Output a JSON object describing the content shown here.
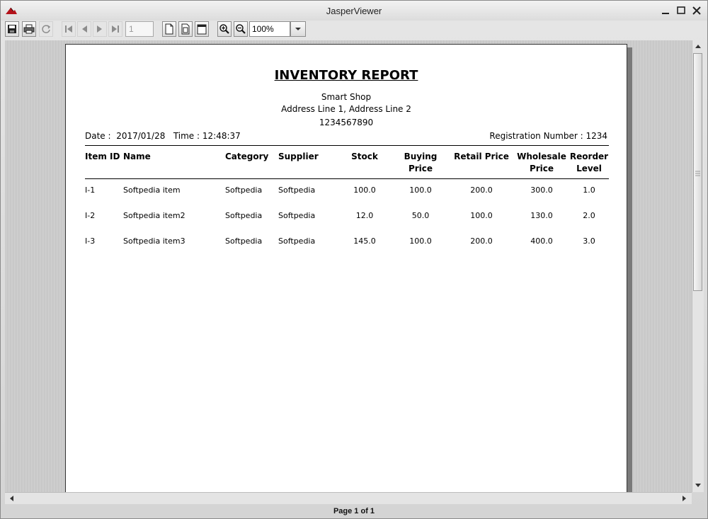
{
  "window": {
    "title": "JasperViewer"
  },
  "toolbar": {
    "page_number": "1",
    "zoom": "100%"
  },
  "report": {
    "title": "INVENTORY REPORT",
    "company": "Smart Shop",
    "address": "Address Line 1, Address Line 2",
    "phone": "1234567890",
    "date_label": "Date :",
    "date": "2017/01/28",
    "time_label": "Time :",
    "time": "12:48:37",
    "registration": "Registration Number : 1234",
    "columns": {
      "id": "Item ID",
      "name": "Name",
      "category": "Category",
      "supplier": "Supplier",
      "stock": "Stock",
      "buying_1": "Buying",
      "buying_2": "Price",
      "retail": "Retail Price",
      "wholesale_1": "Wholesale",
      "wholesale_2": "Price",
      "reorder_1": "Reorder",
      "reorder_2": "Level"
    },
    "rows": [
      {
        "id": "I-1",
        "name": "Softpedia item",
        "category": "Softpedia",
        "supplier": "Softpedia",
        "stock": "100.0",
        "buying": "100.0",
        "retail": "200.0",
        "wholesale": "300.0",
        "reorder": "1.0"
      },
      {
        "id": "I-2",
        "name": "Softpedia item2",
        "category": "Softpedia",
        "supplier": "Softpedia",
        "stock": "12.0",
        "buying": "50.0",
        "retail": "100.0",
        "wholesale": "130.0",
        "reorder": "2.0"
      },
      {
        "id": "I-3",
        "name": "Softpedia item3",
        "category": "Softpedia",
        "supplier": "Softpedia",
        "stock": "145.0",
        "buying": "100.0",
        "retail": "200.0",
        "wholesale": "400.0",
        "reorder": "3.0"
      }
    ]
  },
  "status": {
    "page_info": "Page 1 of 1"
  }
}
